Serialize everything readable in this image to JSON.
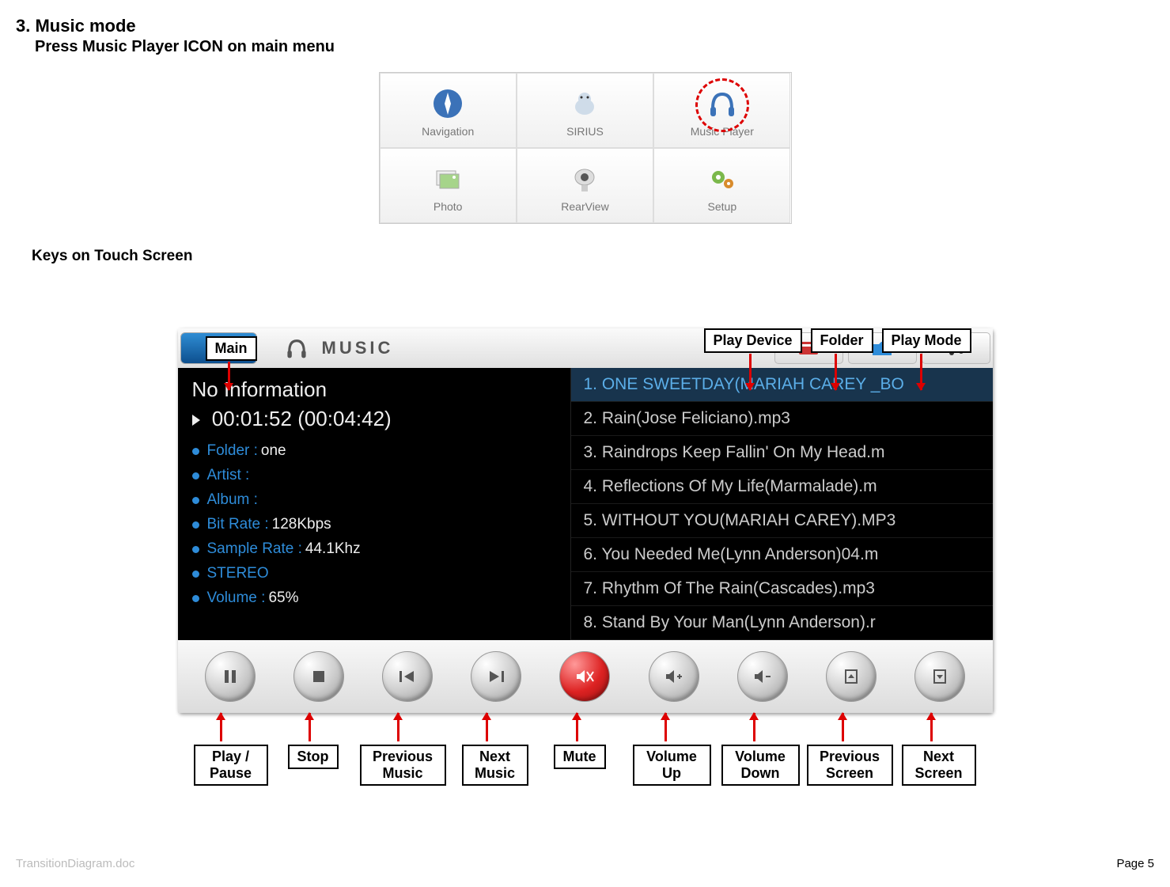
{
  "section_number": "3.",
  "section_title": "Music mode",
  "section_sub": "Press Music Player ICON on main menu",
  "main_menu": {
    "row1": [
      {
        "label": "Navigation",
        "icon": "compass"
      },
      {
        "label": "SIRIUS",
        "icon": "dog"
      },
      {
        "label": "Music Player",
        "icon": "headphones",
        "highlighted": true
      }
    ],
    "row2": [
      {
        "label": "Photo",
        "icon": "photo"
      },
      {
        "label": "RearView",
        "icon": "camera"
      },
      {
        "label": "Setup",
        "icon": "gears"
      }
    ]
  },
  "keys_heading": "Keys on Touch Screen",
  "top_labels": {
    "main": "Main",
    "play_device": "Play Device",
    "folder": "Folder",
    "play_mode": "Play Mode"
  },
  "player": {
    "music_label": "MUSIC",
    "info_title": "No Information",
    "elapsed": "00:01:52",
    "total": "(00:04:42)",
    "fields": [
      {
        "label": "Folder :",
        "value": "one"
      },
      {
        "label": "Artist :",
        "value": ""
      },
      {
        "label": "Album :",
        "value": ""
      },
      {
        "label": "Bit Rate :",
        "value": "128Kbps"
      },
      {
        "label": "Sample Rate :",
        "value": "44.1Khz"
      },
      {
        "label": "STEREO",
        "value": ""
      },
      {
        "label": "Volume :",
        "value": "65%"
      }
    ],
    "tracks": [
      "1. ONE SWEETDAY(MARIAH CAREY _BO",
      "2. Rain(Jose Feliciano).mp3",
      "3. Raindrops Keep Fallin' On My Head.m",
      "4. Reflections Of My Life(Marmalade).m",
      "5. WITHOUT YOU(MARIAH CAREY).MP3",
      "6. You Needed Me(Lynn Anderson)04.m",
      "7. Rhythm Of The Rain(Cascades).mp3",
      "8. Stand By Your Man(Lynn Anderson).r"
    ]
  },
  "bottom_labels": {
    "play_pause": "Play  / Pause",
    "stop": "Stop",
    "prev_music": "Previous Music",
    "next_music": "Next Music",
    "mute": "Mute",
    "vol_up": "Volume Up",
    "vol_down": "Volume Down",
    "prev_screen": "Previous Screen",
    "next_screen": "Next Screen"
  },
  "footer_file": "TransitionDiagram.doc",
  "page_number": "Page 5"
}
